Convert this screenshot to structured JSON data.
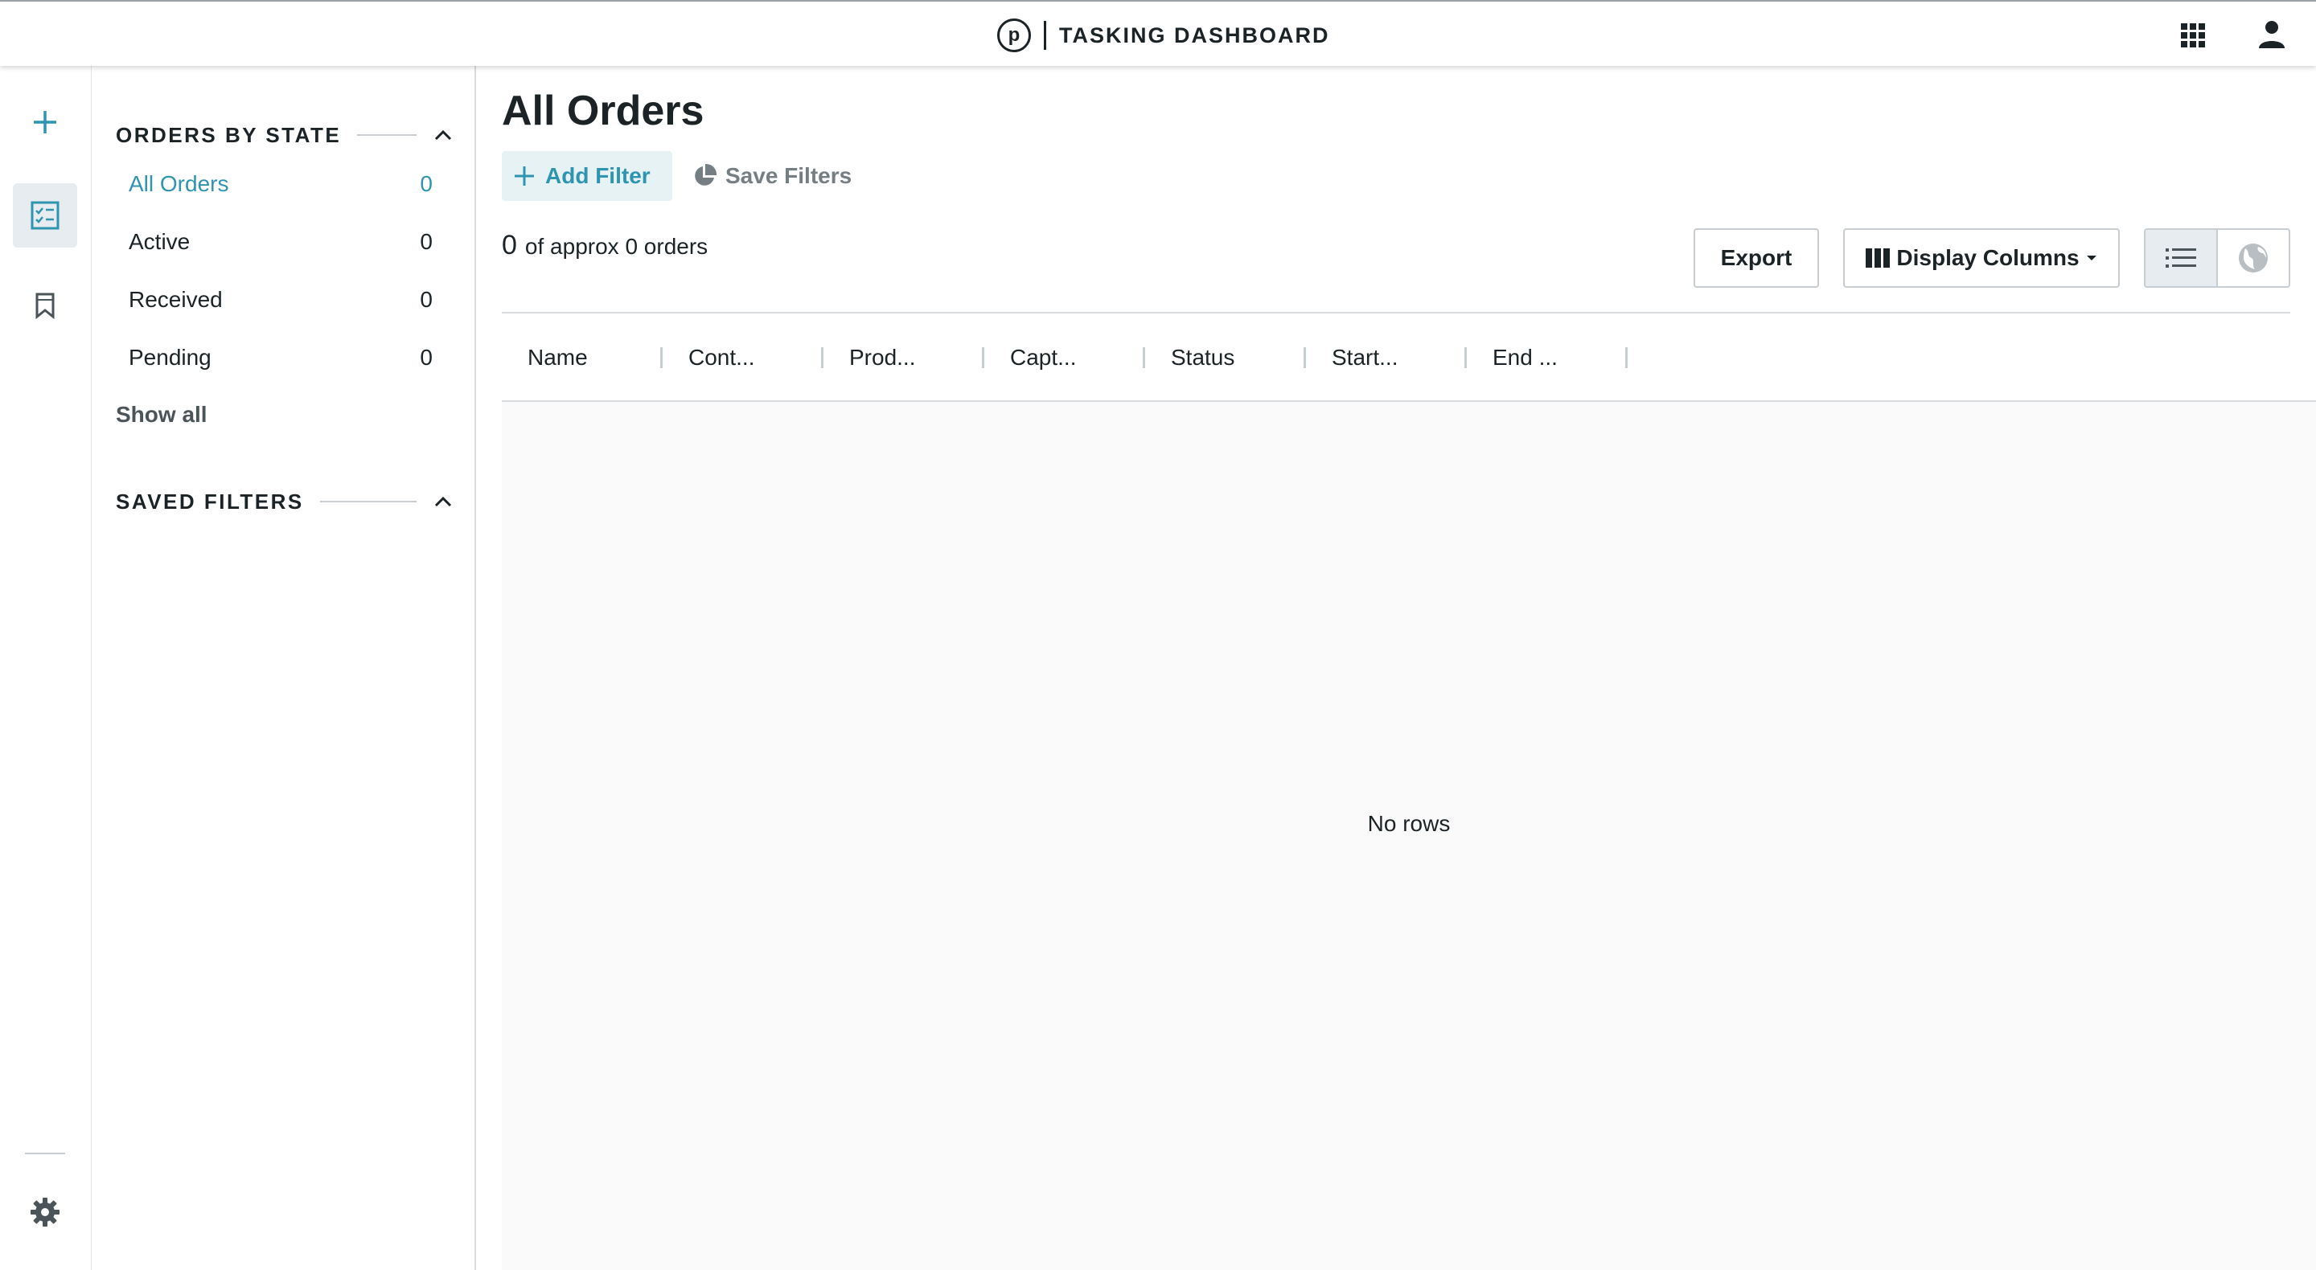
{
  "header": {
    "logo_letter": "p",
    "title": "TASKING DASHBOARD",
    "apps_icon": "apps-grid-icon",
    "user_icon": "person-icon"
  },
  "rail": {
    "items": [
      {
        "icon": "plus-icon",
        "active": false
      },
      {
        "icon": "checklist-icon",
        "active": true
      },
      {
        "icon": "bookmark-icon",
        "active": false
      }
    ],
    "bottom_icon": "gear-icon"
  },
  "sidebar": {
    "orders_by_state": {
      "title": "ORDERS BY STATE",
      "items": [
        {
          "label": "All Orders",
          "count": "0",
          "selected": true
        },
        {
          "label": "Active",
          "count": "0",
          "selected": false
        },
        {
          "label": "Received",
          "count": "0",
          "selected": false
        },
        {
          "label": "Pending",
          "count": "0",
          "selected": false
        }
      ],
      "show_all": "Show all"
    },
    "saved_filters": {
      "title": "SAVED FILTERS"
    }
  },
  "main": {
    "title": "All Orders",
    "add_filter": "Add Filter",
    "save_filters": "Save Filters",
    "count": "0",
    "count_suffix": "of approx 0 orders",
    "export": "Export",
    "display_columns": "Display Columns",
    "columns": [
      "Name",
      "Cont...",
      "Prod...",
      "Capt...",
      "Status",
      "Start...",
      "End ..."
    ],
    "empty_text": "No rows"
  },
  "colors": {
    "accent": "#2f94b0",
    "text": "#1b2327",
    "muted": "#757e83",
    "selected_bg": "#e6ecef"
  }
}
